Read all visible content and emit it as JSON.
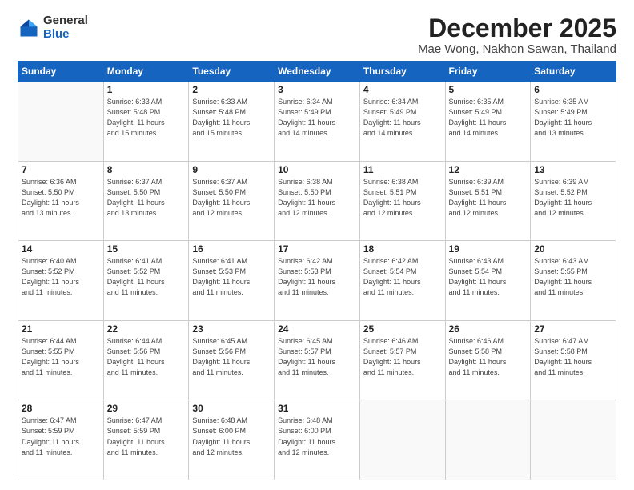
{
  "logo": {
    "general": "General",
    "blue": "Blue"
  },
  "title": {
    "month": "December 2025",
    "location": "Mae Wong, Nakhon Sawan, Thailand"
  },
  "headers": [
    "Sunday",
    "Monday",
    "Tuesday",
    "Wednesday",
    "Thursday",
    "Friday",
    "Saturday"
  ],
  "weeks": [
    [
      {
        "day": "",
        "info": ""
      },
      {
        "day": "1",
        "info": "Sunrise: 6:33 AM\nSunset: 5:48 PM\nDaylight: 11 hours\nand 15 minutes."
      },
      {
        "day": "2",
        "info": "Sunrise: 6:33 AM\nSunset: 5:48 PM\nDaylight: 11 hours\nand 15 minutes."
      },
      {
        "day": "3",
        "info": "Sunrise: 6:34 AM\nSunset: 5:49 PM\nDaylight: 11 hours\nand 14 minutes."
      },
      {
        "day": "4",
        "info": "Sunrise: 6:34 AM\nSunset: 5:49 PM\nDaylight: 11 hours\nand 14 minutes."
      },
      {
        "day": "5",
        "info": "Sunrise: 6:35 AM\nSunset: 5:49 PM\nDaylight: 11 hours\nand 14 minutes."
      },
      {
        "day": "6",
        "info": "Sunrise: 6:35 AM\nSunset: 5:49 PM\nDaylight: 11 hours\nand 13 minutes."
      }
    ],
    [
      {
        "day": "7",
        "info": "Sunrise: 6:36 AM\nSunset: 5:50 PM\nDaylight: 11 hours\nand 13 minutes."
      },
      {
        "day": "8",
        "info": "Sunrise: 6:37 AM\nSunset: 5:50 PM\nDaylight: 11 hours\nand 13 minutes."
      },
      {
        "day": "9",
        "info": "Sunrise: 6:37 AM\nSunset: 5:50 PM\nDaylight: 11 hours\nand 12 minutes."
      },
      {
        "day": "10",
        "info": "Sunrise: 6:38 AM\nSunset: 5:50 PM\nDaylight: 11 hours\nand 12 minutes."
      },
      {
        "day": "11",
        "info": "Sunrise: 6:38 AM\nSunset: 5:51 PM\nDaylight: 11 hours\nand 12 minutes."
      },
      {
        "day": "12",
        "info": "Sunrise: 6:39 AM\nSunset: 5:51 PM\nDaylight: 11 hours\nand 12 minutes."
      },
      {
        "day": "13",
        "info": "Sunrise: 6:39 AM\nSunset: 5:52 PM\nDaylight: 11 hours\nand 12 minutes."
      }
    ],
    [
      {
        "day": "14",
        "info": "Sunrise: 6:40 AM\nSunset: 5:52 PM\nDaylight: 11 hours\nand 11 minutes."
      },
      {
        "day": "15",
        "info": "Sunrise: 6:41 AM\nSunset: 5:52 PM\nDaylight: 11 hours\nand 11 minutes."
      },
      {
        "day": "16",
        "info": "Sunrise: 6:41 AM\nSunset: 5:53 PM\nDaylight: 11 hours\nand 11 minutes."
      },
      {
        "day": "17",
        "info": "Sunrise: 6:42 AM\nSunset: 5:53 PM\nDaylight: 11 hours\nand 11 minutes."
      },
      {
        "day": "18",
        "info": "Sunrise: 6:42 AM\nSunset: 5:54 PM\nDaylight: 11 hours\nand 11 minutes."
      },
      {
        "day": "19",
        "info": "Sunrise: 6:43 AM\nSunset: 5:54 PM\nDaylight: 11 hours\nand 11 minutes."
      },
      {
        "day": "20",
        "info": "Sunrise: 6:43 AM\nSunset: 5:55 PM\nDaylight: 11 hours\nand 11 minutes."
      }
    ],
    [
      {
        "day": "21",
        "info": "Sunrise: 6:44 AM\nSunset: 5:55 PM\nDaylight: 11 hours\nand 11 minutes."
      },
      {
        "day": "22",
        "info": "Sunrise: 6:44 AM\nSunset: 5:56 PM\nDaylight: 11 hours\nand 11 minutes."
      },
      {
        "day": "23",
        "info": "Sunrise: 6:45 AM\nSunset: 5:56 PM\nDaylight: 11 hours\nand 11 minutes."
      },
      {
        "day": "24",
        "info": "Sunrise: 6:45 AM\nSunset: 5:57 PM\nDaylight: 11 hours\nand 11 minutes."
      },
      {
        "day": "25",
        "info": "Sunrise: 6:46 AM\nSunset: 5:57 PM\nDaylight: 11 hours\nand 11 minutes."
      },
      {
        "day": "26",
        "info": "Sunrise: 6:46 AM\nSunset: 5:58 PM\nDaylight: 11 hours\nand 11 minutes."
      },
      {
        "day": "27",
        "info": "Sunrise: 6:47 AM\nSunset: 5:58 PM\nDaylight: 11 hours\nand 11 minutes."
      }
    ],
    [
      {
        "day": "28",
        "info": "Sunrise: 6:47 AM\nSunset: 5:59 PM\nDaylight: 11 hours\nand 11 minutes."
      },
      {
        "day": "29",
        "info": "Sunrise: 6:47 AM\nSunset: 5:59 PM\nDaylight: 11 hours\nand 11 minutes."
      },
      {
        "day": "30",
        "info": "Sunrise: 6:48 AM\nSunset: 6:00 PM\nDaylight: 11 hours\nand 12 minutes."
      },
      {
        "day": "31",
        "info": "Sunrise: 6:48 AM\nSunset: 6:00 PM\nDaylight: 11 hours\nand 12 minutes."
      },
      {
        "day": "",
        "info": ""
      },
      {
        "day": "",
        "info": ""
      },
      {
        "day": "",
        "info": ""
      }
    ]
  ]
}
